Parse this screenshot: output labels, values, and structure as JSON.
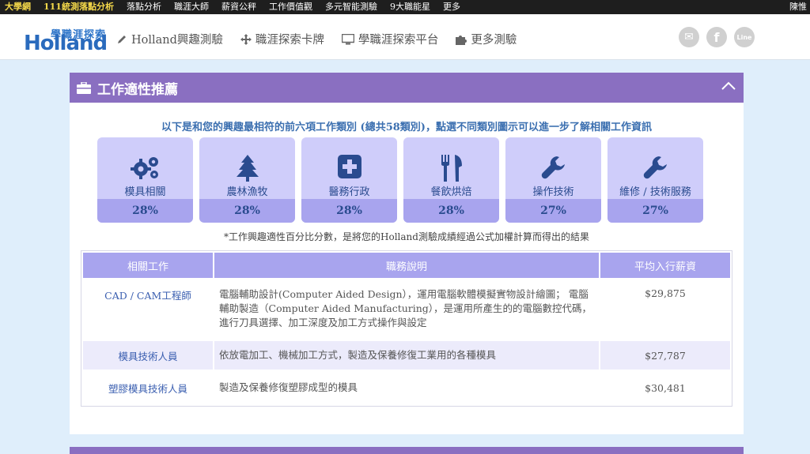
{
  "topnav": {
    "brand": "大學網",
    "highlight": "111統測落點分析",
    "items": [
      "落點分析",
      "職涯大師",
      "薪資公秤",
      "工作價值觀",
      "多元智能測驗",
      "9大職能星",
      "更多"
    ],
    "user": "陳惟"
  },
  "header": {
    "logo_zh": "學職涯探索",
    "logo_en": "Holland",
    "nav": [
      {
        "label": "Holland興趣測驗",
        "icon": "pencil-icon"
      },
      {
        "label": "職涯探索卡牌",
        "icon": "move-icon"
      },
      {
        "label": "學職涯探索平台",
        "icon": "monitor-icon"
      },
      {
        "label": "更多測驗",
        "icon": "puzzle-icon"
      }
    ],
    "social": [
      {
        "icon": "mail-icon",
        "text": "✉"
      },
      {
        "icon": "facebook-icon",
        "text": "f"
      },
      {
        "icon": "line-icon",
        "text": "Line"
      }
    ]
  },
  "panel": {
    "title": "工作適性推薦",
    "intro": "以下是和您的興趣最相符的前六項工作類別 (總共58類別)，點選不同類別圖示可以進一步了解相關工作資訊",
    "cards": [
      {
        "label": "模具相關",
        "percent": "28%",
        "icon": "gears-icon"
      },
      {
        "label": "農林漁牧",
        "percent": "28%",
        "icon": "tree-icon"
      },
      {
        "label": "醫務行政",
        "percent": "28%",
        "icon": "medical-icon"
      },
      {
        "label": "餐飲烘焙",
        "percent": "28%",
        "icon": "cutlery-icon"
      },
      {
        "label": "操作技術",
        "percent": "27%",
        "icon": "wrench-icon"
      },
      {
        "label": "維修 / 技術服務",
        "percent": "27%",
        "icon": "wrench-icon"
      }
    ],
    "note": "*工作興趣適性百分比分數，是將您的Holland測驗成績經過公式加權計算而得出的結果",
    "table": {
      "headers": [
        "相關工作",
        "職務說明",
        "平均入行薪資"
      ],
      "rows": [
        {
          "name": "CAD / CAM工程師",
          "desc": "電腦輔助設計(Computer Aided Design），運用電腦軟體模擬實物設計繪圖； 電腦輔助製造（Computer Aided Manufacturing），是運用所產生的的電腦數控代碼，進行刀具選擇、加工深度及加工方式操作與設定",
          "salary": "$29,875"
        },
        {
          "name": "模具技術人員",
          "desc": "依放電加工、機械加工方式，製造及保養修復工業用的各種模具",
          "salary": "$27,787"
        },
        {
          "name": "塑膠模具技術人員",
          "desc": "製造及保養修復塑膠成型的模具",
          "salary": "$30,481"
        }
      ]
    }
  },
  "colors": {
    "purple": "#8a6fc1",
    "card": "#cfcdfa",
    "card_pct": "#a8a4ee",
    "bg": "#dfeefb"
  }
}
